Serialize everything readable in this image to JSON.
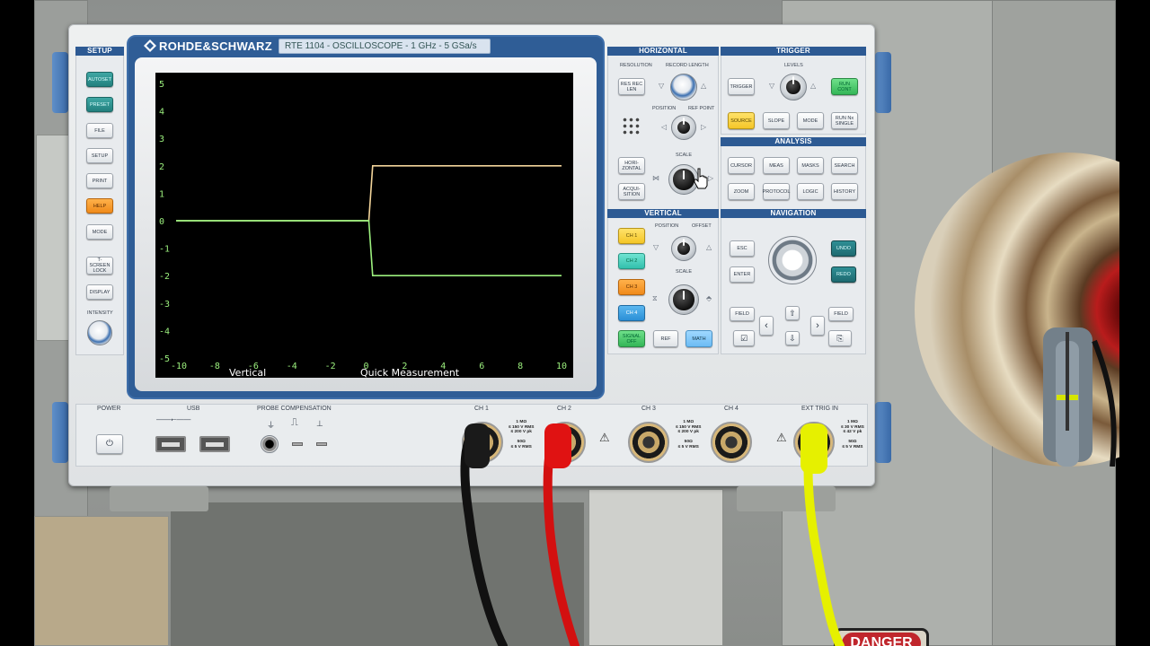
{
  "brand": "ROHDE&SCHWARZ",
  "model": "RTE 1104 - OSCILLOSCOPE - 1 GHz - 5 GSa/s",
  "sections": {
    "setup": "SETUP",
    "horizontal": "HORIZONTAL",
    "trigger": "TRIGGER",
    "analysis": "ANALYSIS",
    "vertical": "VERTICAL",
    "navigation": "NAVIGATION"
  },
  "setup_keys": [
    "AUTOSET",
    "PRESET",
    "FILE",
    "SETUP",
    "PRINT",
    "HELP",
    "MODE",
    "T-SCREEN LOCK",
    "DISPLAY"
  ],
  "intensity_label": "INTENSITY",
  "horizontal": {
    "resolution_label": "RESOLUTION",
    "record_length_label": "RECORD LENGTH",
    "res_key": "RES REC LEN",
    "position_label": "POSITION",
    "ref_point_label": "REF POINT",
    "scale_label": "SCALE",
    "horizontal_key": "HORI- ZONTAL",
    "acquisition_key": "ACQUI- SITION"
  },
  "trigger": {
    "levels_label": "LEVELS",
    "trigger_key": "TRIGGER",
    "run_cont_key": "RUN CONT",
    "source_key": "SOURCE",
    "slope_key": "SLOPE",
    "mode_key": "MODE",
    "run_single_key": "RUN Nx SINGLE"
  },
  "analysis_keys": [
    "CURSOR",
    "MEAS",
    "MASKS",
    "SEARCH",
    "ZOOM",
    "PROTOCOL",
    "LOGIC",
    "HISTORY"
  ],
  "vertical": {
    "position_label": "POSITION",
    "offset_label": "OFFSET",
    "scale_label": "SCALE",
    "ch1_key": "CH 1",
    "ch2_key": "CH 2",
    "ch3_key": "CH 3",
    "ch4_key": "CH 4",
    "signal_off_key": "SIGNAL OFF",
    "ref_key": "REF",
    "math_key": "MATH"
  },
  "navigation": {
    "esc_key": "ESC",
    "enter_key": "ENTER",
    "undo_key": "UNDO",
    "redo_key": "REDO",
    "field_left": "FIELD",
    "field_right": "FIELD"
  },
  "bottom": {
    "power_label": "POWER",
    "usb_label": "USB",
    "probe_comp_label": "PROBE COMPENSATION",
    "ch1_label": "CH 1",
    "ch2_label": "CH 2",
    "ch3_label": "CH 3",
    "ch4_label": "CH 4",
    "ext_trig_label": "EXT TRIG IN",
    "spec_ch12": "1 MΩ\n≤ 150 V RMS\n≤ 200 V pk\n\n50Ω\n≤ 5 V RMS",
    "spec_ch34": "1 MΩ\n≤ 150 V RMS\n≤ 200 V pk\n\n50Ω\n≤ 5 V RMS",
    "spec_ext": "1 MΩ\n≤ 30 V RMS\n≤ 42 V pk\n\n50Ω\n≤ 5 V RMS"
  },
  "scope_display": {
    "y_ticks": [
      "5",
      "4",
      "3",
      "2",
      "1",
      "0",
      "-1",
      "-2",
      "-3",
      "-4",
      "-5"
    ],
    "x_ticks": [
      "-10",
      "-8",
      "-6",
      "-4",
      "-2",
      "0",
      "2",
      "4",
      "6",
      "8",
      "10"
    ],
    "bottom_left_label": "Vertical",
    "bottom_right_label": "Quick Measurement",
    "trace_color_upper": "#f2d49a",
    "trace_color_lower": "#9cf07e",
    "trace_color_flat": "#9cf07e"
  },
  "chart_data": {
    "type": "line",
    "x_range": [
      -10,
      10
    ],
    "y_range": [
      -5,
      5
    ],
    "series": [
      {
        "x": [
          -10,
          0,
          0.2,
          10
        ],
        "y": [
          0,
          0,
          2,
          2
        ]
      },
      {
        "x": [
          -10,
          0,
          0.2,
          10
        ],
        "y": [
          0,
          0,
          -2,
          -2
        ]
      }
    ]
  },
  "background_sign": "DANGER"
}
